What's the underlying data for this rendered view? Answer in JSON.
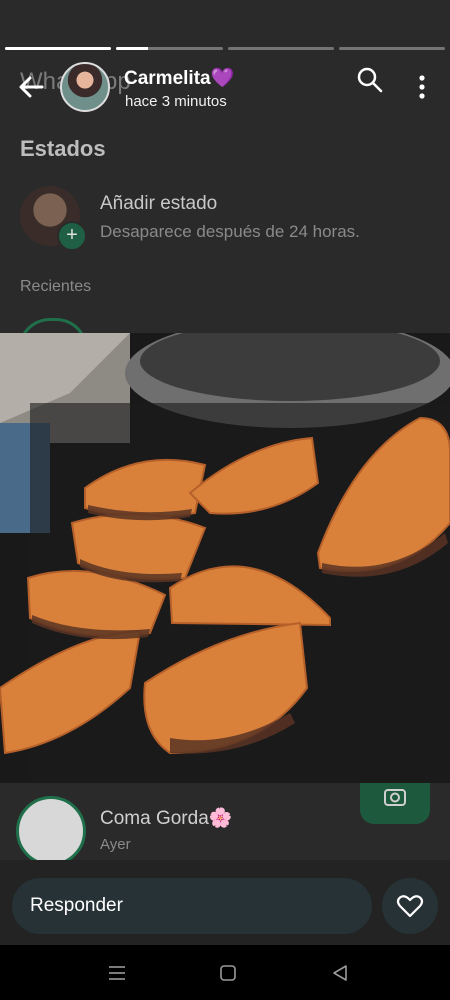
{
  "background_app": {
    "header_title": "WhatsApp",
    "section_title": "Estados",
    "my_status": {
      "title": "Añadir estado",
      "subtitle": "Desaparece después de 24 horas."
    },
    "recent_label": "Recientes",
    "contacts": [
      {
        "name": "Coma Gorda🌸",
        "time": "Ayer"
      }
    ]
  },
  "status": {
    "progress": [
      1.0,
      0.3,
      0.0,
      0.0
    ],
    "contact_name": "Carmelita💜",
    "timestamp": "hace 3 minutos"
  },
  "icons": {
    "back": "arrow-left-icon",
    "search": "search-icon",
    "menu": "more-vertical-icon",
    "like": "heart-icon"
  },
  "reply": {
    "placeholder": "Responder"
  },
  "colors": {
    "reply_bg": "#263236",
    "accent_green": "#1f6f4a"
  }
}
